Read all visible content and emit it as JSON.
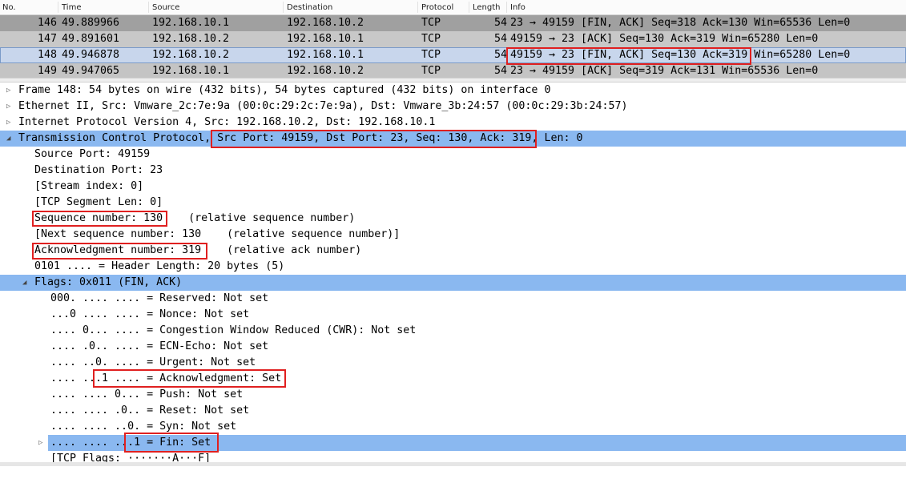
{
  "columns": {
    "no": "No.",
    "time": "Time",
    "source": "Source",
    "destination": "Destination",
    "protocol": "Protocol",
    "length": "Length",
    "info": "Info"
  },
  "packets": [
    {
      "no": "146",
      "time": "49.889966",
      "src": "192.168.10.1",
      "dst": "192.168.10.2",
      "proto": "TCP",
      "len": "54",
      "info": "23 → 49159 [FIN, ACK] Seq=318 Ack=130 Win=65536 Len=0"
    },
    {
      "no": "147",
      "time": "49.891601",
      "src": "192.168.10.2",
      "dst": "192.168.10.1",
      "proto": "TCP",
      "len": "54",
      "info": "49159 → 23 [ACK] Seq=130 Ack=319 Win=65280 Len=0"
    },
    {
      "no": "148",
      "time": "49.946878",
      "src": "192.168.10.2",
      "dst": "192.168.10.1",
      "proto": "TCP",
      "len": "54",
      "info": "49159 → 23 [FIN, ACK] Seq=130 Ack=319 Win=65280 Len=0"
    },
    {
      "no": "149",
      "time": "49.947065",
      "src": "192.168.10.1",
      "dst": "192.168.10.2",
      "proto": "TCP",
      "len": "54",
      "info": "23 → 49159 [ACK] Seq=319 Ack=131 Win=65536 Len=0"
    }
  ],
  "tree": [
    "Frame 148: 54 bytes on wire (432 bits), 54 bytes captured (432 bits) on interface 0",
    "Ethernet II, Src: Vmware_2c:7e:9a (00:0c:29:2c:7e:9a), Dst: Vmware_3b:24:57 (00:0c:29:3b:24:57)",
    "Internet Protocol Version 4, Src: 192.168.10.2, Dst: 192.168.10.1",
    "Transmission Control Protocol, Src Port: 49159, Dst Port: 23, Seq: 130, Ack: 319, Len: 0",
    "Source Port: 49159",
    "Destination Port: 23",
    "[Stream index: 0]",
    "[TCP Segment Len: 0]",
    "Sequence number: 130    (relative sequence number)",
    "[Next sequence number: 130    (relative sequence number)]",
    "Acknowledgment number: 319    (relative ack number)",
    "0101 .... = Header Length: 20 bytes (5)",
    "Flags: 0x011 (FIN, ACK)",
    "000. .... .... = Reserved: Not set",
    "...0 .... .... = Nonce: Not set",
    ".... 0... .... = Congestion Window Reduced (CWR): Not set",
    ".... .0.. .... = ECN-Echo: Not set",
    ".... ..0. .... = Urgent: Not set",
    ".... ...1 .... = Acknowledgment: Set",
    ".... .... 0... = Push: Not set",
    ".... .... .0.. = Reset: Not set",
    ".... .... ..0. = Syn: Not set",
    ".... .... ...1 = Fin: Set",
    "[TCP Flags: ·······A···F]"
  ]
}
